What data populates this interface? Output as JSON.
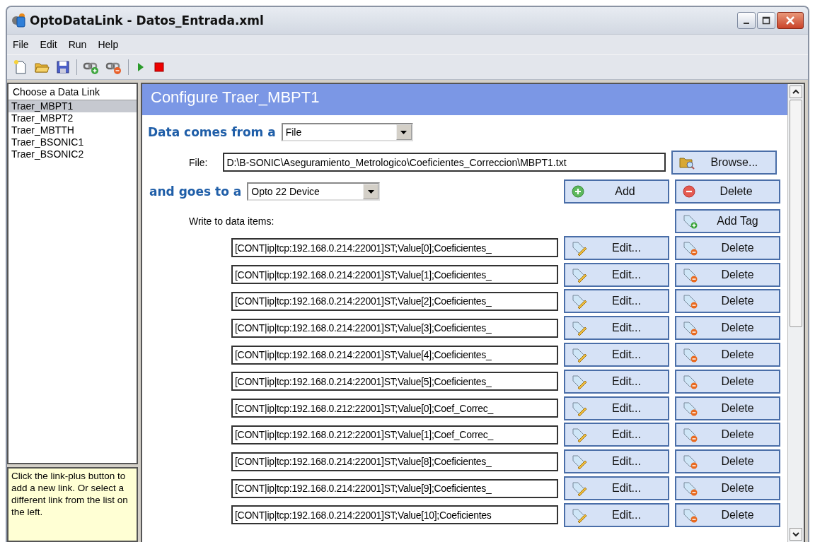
{
  "window": {
    "title": "OptoDataLink - Datos_Entrada.xml"
  },
  "menu": [
    "File",
    "Edit",
    "Run",
    "Help"
  ],
  "toolbar": [
    {
      "kind": "new"
    },
    {
      "kind": "open"
    },
    {
      "kind": "save"
    },
    {
      "kind": "sep"
    },
    {
      "kind": "link-add"
    },
    {
      "kind": "link-remove"
    },
    {
      "kind": "sep"
    },
    {
      "kind": "run"
    },
    {
      "kind": "stop"
    }
  ],
  "sidebar": {
    "header": "Choose a Data Link",
    "items": [
      {
        "label": "Traer_MBPT1",
        "selected": true
      },
      {
        "label": "Traer_MBPT2",
        "selected": false
      },
      {
        "label": "Traer_MBTTH",
        "selected": false
      },
      {
        "label": "Traer_BSONIC1",
        "selected": false
      },
      {
        "label": "Traer_BSONIC2",
        "selected": false
      }
    ],
    "hint": "Click the link-plus button to add a new link.  Or select a different link from the list on the left."
  },
  "panel": {
    "title": "Configure Traer_MBPT1",
    "source_label": "Data comes from a",
    "source_value": "File",
    "file_label": "File:",
    "file_value": "D:\\B-SONIC\\Aseguramiento_Metrologico\\Coeficientes_Correccion\\MBPT1.txt",
    "browse": "Browse...",
    "dest_label": "and goes to a",
    "dest_value": "Opto 22 Device",
    "add": "Add",
    "delete": "Delete",
    "write_label": "Write to data items:",
    "add_tag": "Add Tag",
    "items": [
      {
        "value": "[CONT|ip|tcp:192.168.0.214:22001]ST;Value[0];Coeficientes_",
        "edit": "Edit...",
        "delete": "Delete"
      },
      {
        "value": "[CONT|ip|tcp:192.168.0.214:22001]ST;Value[1];Coeficientes_",
        "edit": "Edit...",
        "delete": "Delete"
      },
      {
        "value": "[CONT|ip|tcp:192.168.0.214:22001]ST;Value[2];Coeficientes_",
        "edit": "Edit...",
        "delete": "Delete"
      },
      {
        "value": "[CONT|ip|tcp:192.168.0.214:22001]ST;Value[3];Coeficientes_",
        "edit": "Edit...",
        "delete": "Delete"
      },
      {
        "value": "[CONT|ip|tcp:192.168.0.214:22001]ST;Value[4];Coeficientes_",
        "edit": "Edit...",
        "delete": "Delete"
      },
      {
        "value": "[CONT|ip|tcp:192.168.0.214:22001]ST;Value[5];Coeficientes_",
        "edit": "Edit...",
        "delete": "Delete"
      },
      {
        "value": "[CONT|ip|tcp:192.168.0.212:22001]ST;Value[0];Coef_Correc_",
        "edit": "Edit...",
        "delete": "Delete"
      },
      {
        "value": "[CONT|ip|tcp:192.168.0.212:22001]ST;Value[1];Coef_Correc_",
        "edit": "Edit...",
        "delete": "Delete"
      },
      {
        "value": "[CONT|ip|tcp:192.168.0.214:22001]ST;Value[8];Coeficientes_",
        "edit": "Edit...",
        "delete": "Delete"
      },
      {
        "value": "[CONT|ip|tcp:192.168.0.214:22001]ST;Value[9];Coeficientes_",
        "edit": "Edit...",
        "delete": "Delete"
      },
      {
        "value": "[CONT|ip|tcp:192.168.0.214:22001]ST;Value[10];Coeficientes",
        "edit": "Edit...",
        "delete": "Delete"
      }
    ]
  }
}
